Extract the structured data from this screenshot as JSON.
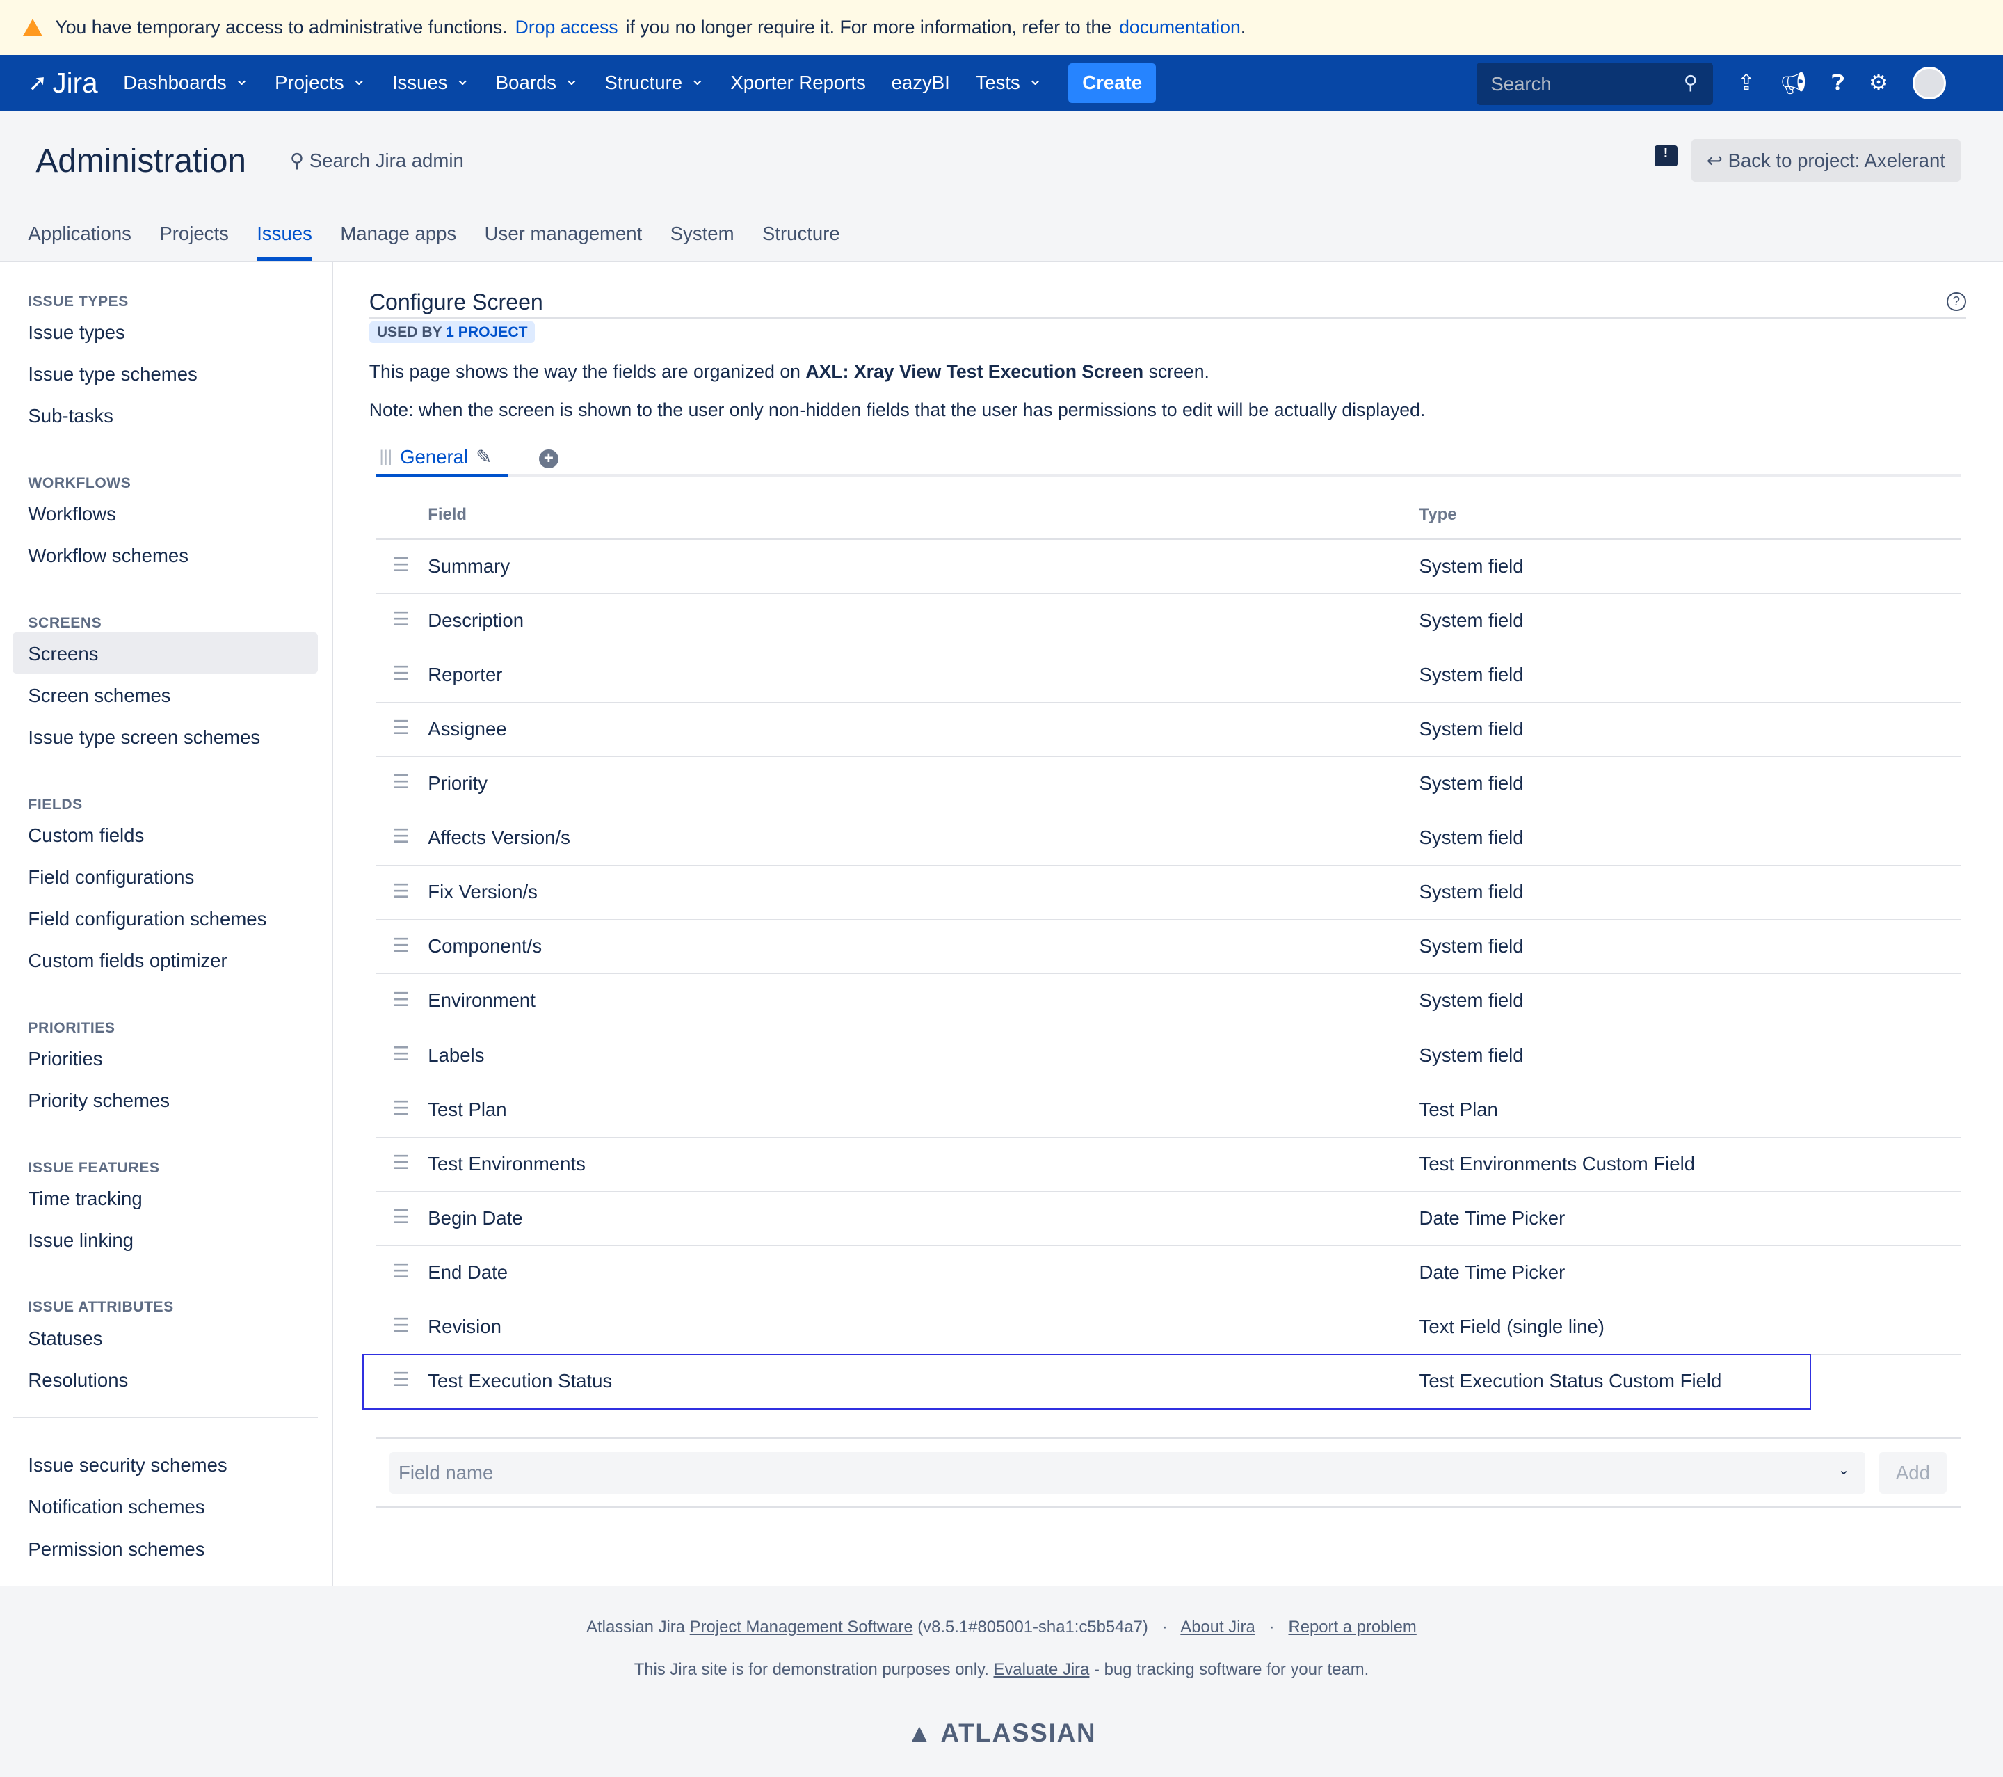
{
  "banner": {
    "text1": "You have temporary access to administrative functions.",
    "link1": "Drop access",
    "text2": "if you no longer require it. For more information, refer to the",
    "link2": "documentation",
    "text3": "."
  },
  "nav": {
    "logo": "Jira",
    "items": [
      {
        "label": "Dashboards",
        "dropdown": true
      },
      {
        "label": "Projects",
        "dropdown": true
      },
      {
        "label": "Issues",
        "dropdown": true
      },
      {
        "label": "Boards",
        "dropdown": true
      },
      {
        "label": "Structure",
        "dropdown": true
      },
      {
        "label": "Xporter Reports"
      },
      {
        "label": "eazyBI"
      },
      {
        "label": "Tests",
        "dropdown": true
      }
    ],
    "create": "Create",
    "search_placeholder": "Search"
  },
  "admin": {
    "title": "Administration",
    "search": "Search Jira admin",
    "back": "Back to project: Axelerant",
    "tabs": [
      "Applications",
      "Projects",
      "Issues",
      "Manage apps",
      "User management",
      "System",
      "Structure"
    ],
    "active_tab": "Issues"
  },
  "sidebar": {
    "sections": [
      {
        "heading": "ISSUE TYPES",
        "items": [
          "Issue types",
          "Issue type schemes",
          "Sub-tasks"
        ]
      },
      {
        "heading": "WORKFLOWS",
        "items": [
          "Workflows",
          "Workflow schemes"
        ]
      },
      {
        "heading": "SCREENS",
        "items": [
          "Screens",
          "Screen schemes",
          "Issue type screen schemes"
        ]
      },
      {
        "heading": "FIELDS",
        "items": [
          "Custom fields",
          "Field configurations",
          "Field configuration schemes",
          "Custom fields optimizer"
        ]
      },
      {
        "heading": "PRIORITIES",
        "items": [
          "Priorities",
          "Priority schemes"
        ]
      },
      {
        "heading": "ISSUE FEATURES",
        "items": [
          "Time tracking",
          "Issue linking"
        ]
      },
      {
        "heading": "ISSUE ATTRIBUTES",
        "items": [
          "Statuses",
          "Resolutions"
        ]
      },
      {
        "heading": "",
        "items": [
          "Issue security schemes",
          "Notification schemes",
          "Permission schemes"
        ]
      }
    ],
    "active": "Screens"
  },
  "main": {
    "title": "Configure Screen",
    "badge_a": "USED BY",
    "badge_b": "1 PROJECT",
    "desc_a": "This page shows the way the fields are organized on",
    "desc_b": "AXL: Xray View Test Execution Screen",
    "desc_c": "screen.",
    "note": "Note: when the screen is shown to the user only non-hidden fields that the user has permissions to edit will be actually displayed.",
    "tab": "General",
    "col_field": "Field",
    "col_type": "Type",
    "rows": [
      [
        "Summary",
        "System field"
      ],
      [
        "Description",
        "System field"
      ],
      [
        "Reporter",
        "System field"
      ],
      [
        "Assignee",
        "System field"
      ],
      [
        "Priority",
        "System field"
      ],
      [
        "Affects Version/s",
        "System field"
      ],
      [
        "Fix Version/s",
        "System field"
      ],
      [
        "Component/s",
        "System field"
      ],
      [
        "Environment",
        "System field"
      ],
      [
        "Labels",
        "System field"
      ],
      [
        "Test Plan",
        "Test Plan"
      ],
      [
        "Test Environments",
        "Test Environments Custom Field"
      ],
      [
        "Begin Date",
        "Date Time Picker"
      ],
      [
        "End Date",
        "Date Time Picker"
      ],
      [
        "Revision",
        "Text Field (single line)"
      ],
      [
        "Test Execution Status",
        "Test Execution Status Custom Field"
      ]
    ],
    "field_placeholder": "Field name",
    "add": "Add"
  },
  "footer": {
    "a": "Atlassian Jira",
    "link1": "Project Management Software",
    "version": "(v8.5.1#805001-sha1:c5b54a7)",
    "sep": "·",
    "link2": "About Jira",
    "link3": "Report a problem",
    "b": "This Jira site is for demonstration purposes only.",
    "link4": "Evaluate Jira",
    "c": "- bug tracking software for your team.",
    "logo": "ATLASSIAN"
  }
}
